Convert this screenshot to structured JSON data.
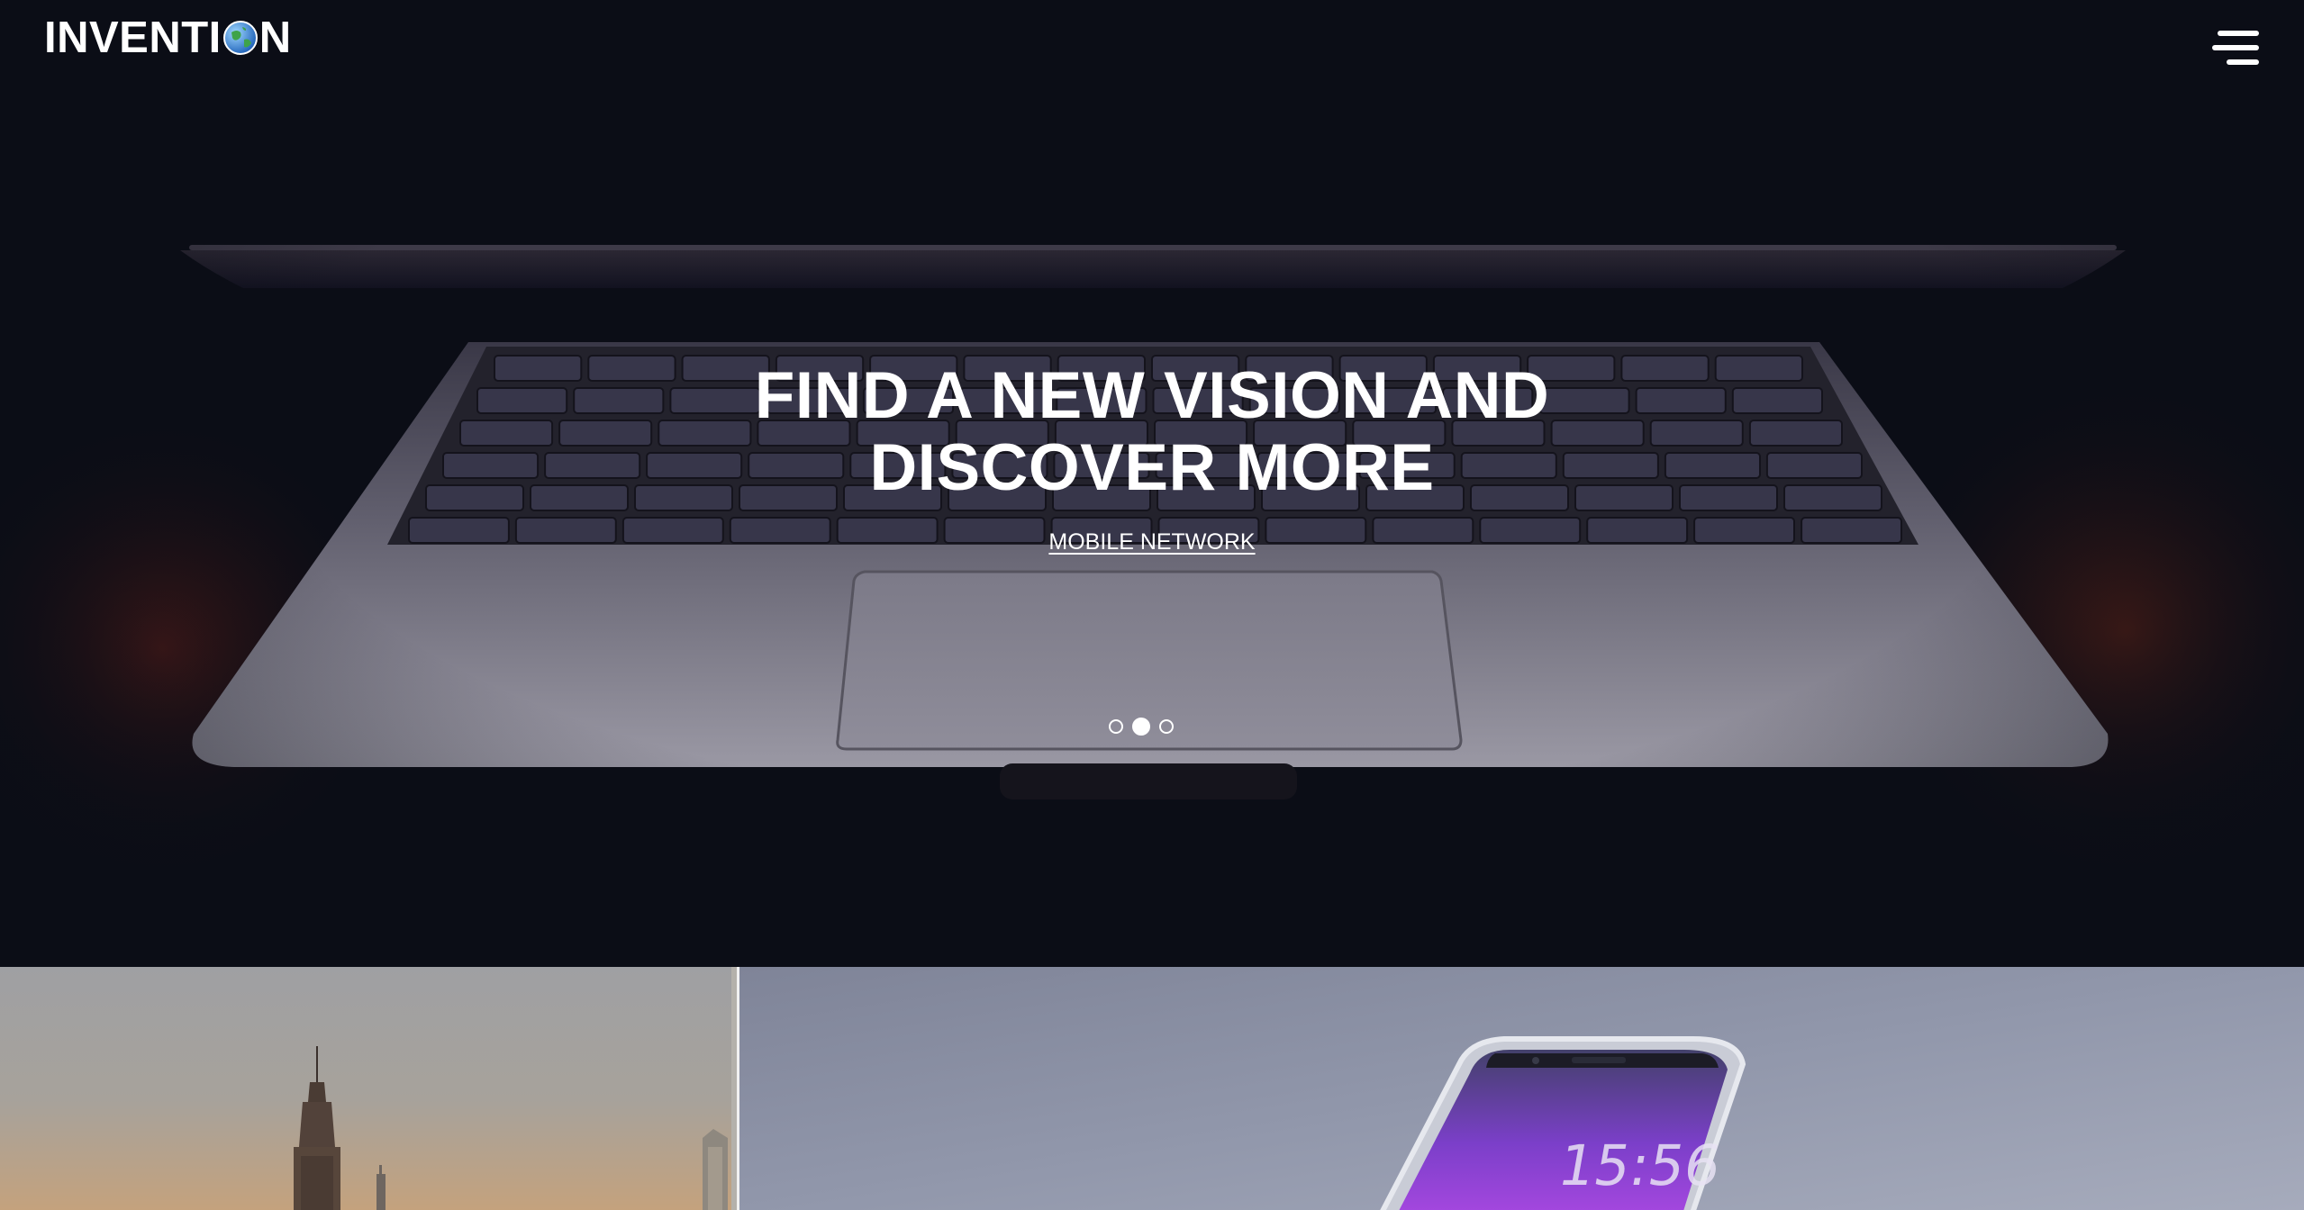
{
  "brand": {
    "name_part1": "INVENTI",
    "name_part2": "N",
    "globe_icon": "globe-icon"
  },
  "nav": {
    "menu_icon": "hamburger-menu-icon"
  },
  "hero": {
    "title": "FIND A NEW VISION AND DISCOVER MORE",
    "link_label": "MOBILE NETWORK",
    "slides": [
      {
        "active": false
      },
      {
        "active": true
      },
      {
        "active": false
      }
    ]
  },
  "tiles": {
    "phone_time": "15:56"
  },
  "colors": {
    "hero_background": "#0b0d16",
    "text": "#ffffff",
    "laptop_body": "#8e8c99",
    "phone_tile_background": "#8d93a7",
    "phone_screen_purple": "#8a3bd6"
  }
}
